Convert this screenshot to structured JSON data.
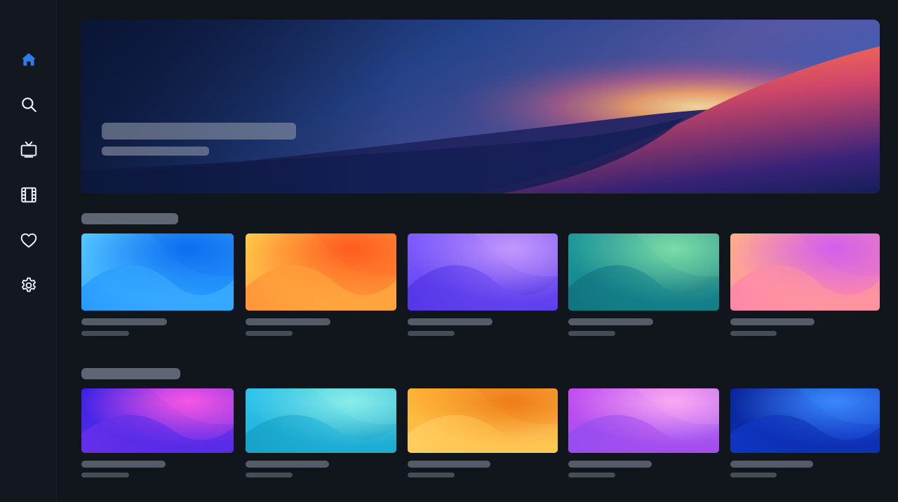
{
  "sidebar": {
    "items": [
      {
        "name": "home",
        "icon": "home-icon",
        "active": true,
        "color": "#2f7bf2"
      },
      {
        "name": "search",
        "icon": "search-icon",
        "active": false,
        "color": "#eef1f6"
      },
      {
        "name": "live-tv",
        "icon": "tv-icon",
        "active": false,
        "color": "#eef1f6"
      },
      {
        "name": "movies",
        "icon": "film-icon",
        "active": false,
        "color": "#eef1f6"
      },
      {
        "name": "favorites",
        "icon": "heart-icon",
        "active": false,
        "color": "#eef1f6"
      },
      {
        "name": "settings",
        "icon": "gear-icon",
        "active": false,
        "color": "#eef1f6"
      }
    ]
  },
  "hero": {
    "colors": [
      "#0a1337",
      "#2c4f9f",
      "#f6b37a",
      "#ef5a3a",
      "#15205a"
    ]
  },
  "rows": [
    {
      "cards": [
        {
          "name": "card-blue",
          "colors": [
            "#57c6ff",
            "#0b6cf0",
            "#1e93ff"
          ]
        },
        {
          "name": "card-orange",
          "colors": [
            "#ffc94a",
            "#ff5a1f",
            "#ff8a35"
          ]
        },
        {
          "name": "card-violet",
          "colors": [
            "#7d5cff",
            "#c79bff",
            "#4b2ee0"
          ]
        },
        {
          "name": "card-teal",
          "colors": [
            "#1c9a9c",
            "#7fe0a9",
            "#0f6c7a"
          ]
        },
        {
          "name": "card-peach",
          "colors": [
            "#ffb08a",
            "#d05df0",
            "#ff7fb0"
          ]
        }
      ]
    },
    {
      "cards": [
        {
          "name": "card-indigo",
          "colors": [
            "#3a22e6",
            "#ff58e3",
            "#6e32ea"
          ]
        },
        {
          "name": "card-cyan",
          "colors": [
            "#2ec4ee",
            "#8ff0ea",
            "#129bc0"
          ]
        },
        {
          "name": "card-amber",
          "colors": [
            "#ffb232",
            "#ee7a16",
            "#ffd36a"
          ]
        },
        {
          "name": "card-magenta",
          "colors": [
            "#c44df0",
            "#ffaef5",
            "#8a4ff0"
          ]
        },
        {
          "name": "card-royal",
          "colors": [
            "#0a2496",
            "#3c8cff",
            "#1038cc"
          ]
        }
      ]
    }
  ]
}
